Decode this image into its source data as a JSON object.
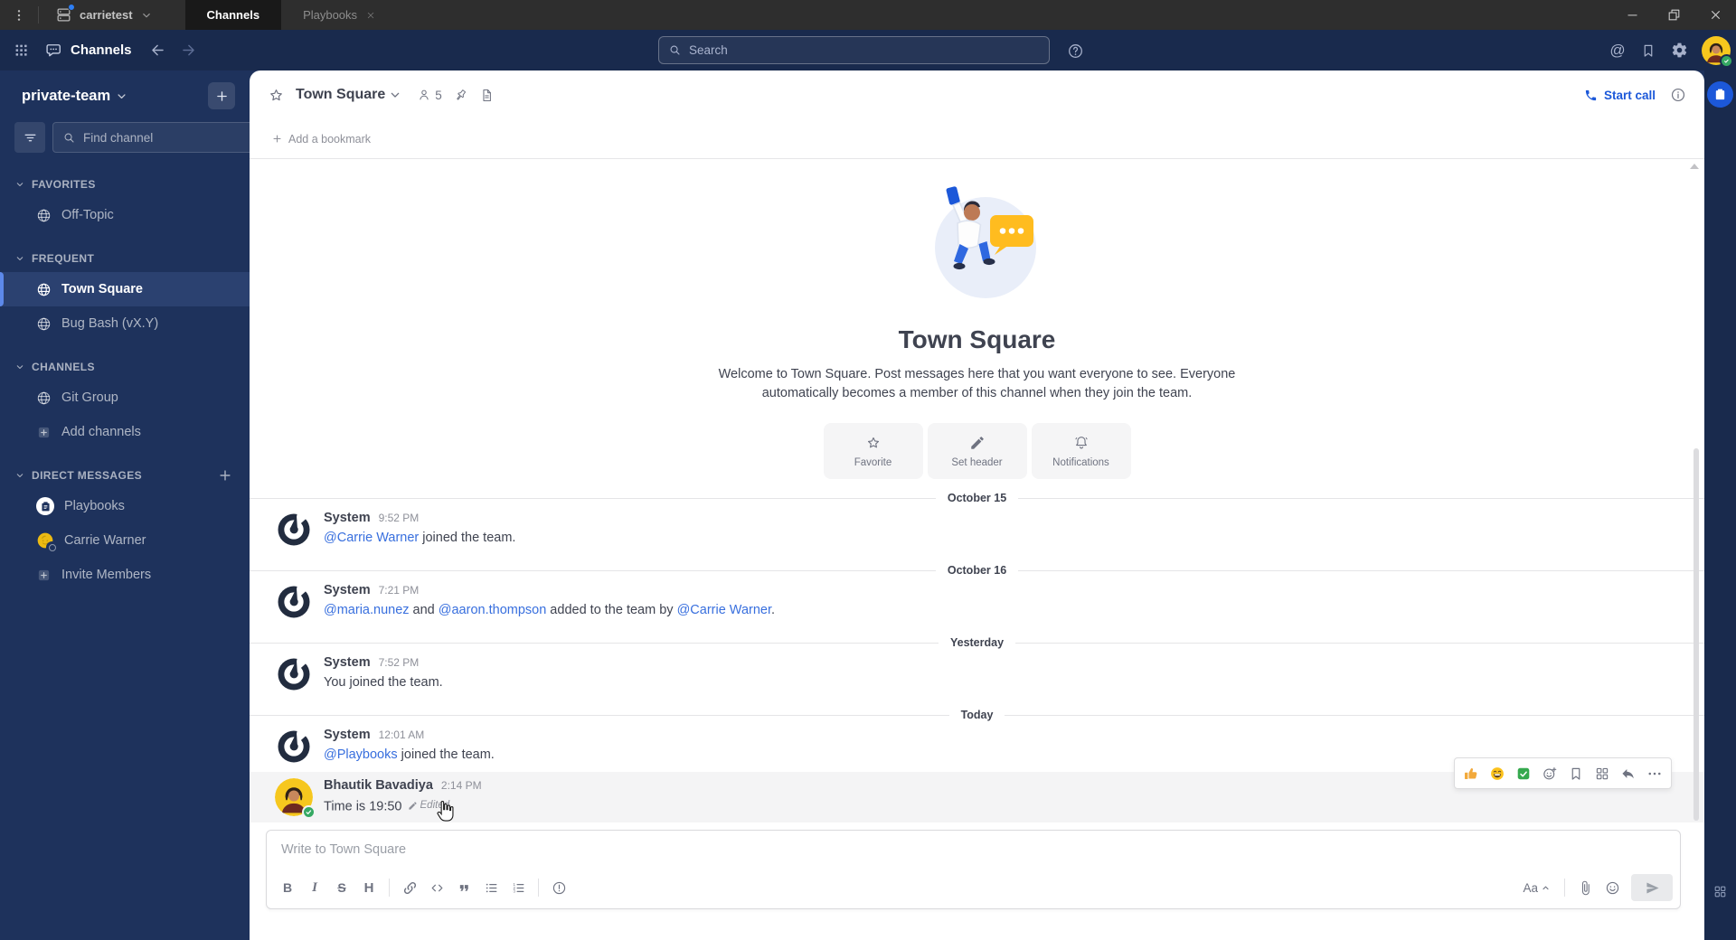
{
  "titlebar": {
    "server_name": "carrietest",
    "tabs": [
      {
        "label": "Channels",
        "active": true,
        "closable": false
      },
      {
        "label": "Playbooks",
        "active": false,
        "closable": true
      }
    ]
  },
  "header": {
    "product_name": "Channels",
    "search_placeholder": "Search"
  },
  "sidebar": {
    "team_name": "private-team",
    "find_channel_placeholder": "Find channel",
    "sections": [
      {
        "label": "FAVORITES",
        "add_button": false,
        "items": [
          {
            "label": "Off-Topic",
            "icon": "globe",
            "active": false
          }
        ]
      },
      {
        "label": "FREQUENT",
        "add_button": false,
        "items": [
          {
            "label": "Town Square",
            "icon": "globe",
            "active": true
          },
          {
            "label": "Bug Bash (vX.Y)",
            "icon": "globe",
            "active": false
          }
        ]
      },
      {
        "label": "CHANNELS",
        "add_button": false,
        "items": [
          {
            "label": "Git Group",
            "icon": "globe",
            "active": false
          },
          {
            "label": "Add channels",
            "icon": "plus-box",
            "active": false
          }
        ]
      },
      {
        "label": "DIRECT MESSAGES",
        "add_button": true,
        "items": [
          {
            "label": "Playbooks",
            "icon": "playbooks-avatar",
            "active": false
          },
          {
            "label": "Carrie Warner",
            "icon": "carrie-avatar",
            "active": false
          },
          {
            "label": "Invite Members",
            "icon": "plus-box",
            "active": false
          }
        ]
      }
    ]
  },
  "channel_header": {
    "name": "Town Square",
    "member_count": "5",
    "start_call_label": "Start call",
    "add_bookmark_label": "Add a bookmark"
  },
  "intro": {
    "title": "Town Square",
    "description": "Welcome to Town Square. Post messages here that you want everyone to see. Everyone automatically becomes a member of this channel when they join the team.",
    "actions": [
      {
        "label": "Favorite",
        "icon": "star"
      },
      {
        "label": "Set header",
        "icon": "pencil"
      },
      {
        "label": "Notifications",
        "icon": "bell"
      }
    ]
  },
  "timeline": [
    {
      "type": "divider",
      "label": "October 15"
    },
    {
      "type": "message",
      "author": "System",
      "avatar": "system-logo",
      "time": "9:52 PM",
      "segments": [
        {
          "text": "@Carrie Warner",
          "link": true
        },
        {
          "text": " joined the team.",
          "link": false
        }
      ]
    },
    {
      "type": "divider",
      "label": "October 16"
    },
    {
      "type": "message",
      "author": "System",
      "avatar": "system-logo",
      "time": "7:21 PM",
      "segments": [
        {
          "text": "@maria.nunez",
          "link": true
        },
        {
          "text": " and ",
          "link": false
        },
        {
          "text": "@aaron.thompson",
          "link": true
        },
        {
          "text": " added to the team by ",
          "link": false
        },
        {
          "text": "@Carrie Warner",
          "link": true
        },
        {
          "text": ".",
          "link": false
        }
      ]
    },
    {
      "type": "divider",
      "label": "Yesterday"
    },
    {
      "type": "message",
      "author": "System",
      "avatar": "system-logo",
      "time": "7:52 PM",
      "segments": [
        {
          "text": "You joined the team.",
          "link": false
        }
      ]
    },
    {
      "type": "divider",
      "label": "Today"
    },
    {
      "type": "message",
      "author": "System",
      "avatar": "system-logo",
      "time": "12:01 AM",
      "segments": [
        {
          "text": "@Playbooks",
          "link": true
        },
        {
          "text": " joined the team.",
          "link": false
        }
      ]
    },
    {
      "type": "message",
      "author": "Bhautik Bavadiya",
      "avatar": "bhautik-avatar",
      "time": "2:14 PM",
      "hovered": true,
      "segments": [
        {
          "text": "Time is 19:50",
          "link": false
        }
      ],
      "edited_label": "Edited"
    }
  ],
  "message_actions": [
    {
      "name": "thumbs-up-reaction",
      "icon": "emoji-thumb"
    },
    {
      "name": "grinning-reaction",
      "icon": "emoji-grin"
    },
    {
      "name": "check-mark-reaction",
      "icon": "emoji-check"
    },
    {
      "name": "add-reaction",
      "icon": "emoticon-plus"
    },
    {
      "name": "save-message",
      "icon": "bookmark"
    },
    {
      "name": "message-apps",
      "icon": "grid4"
    },
    {
      "name": "reply",
      "icon": "reply"
    },
    {
      "name": "more-actions",
      "icon": "dots-h"
    }
  ],
  "composer": {
    "placeholder": "Write to Town Square",
    "format_buttons": [
      {
        "name": "bold",
        "glyph": "B"
      },
      {
        "name": "italic",
        "glyph": "I"
      },
      {
        "name": "strikethrough",
        "glyph": "S"
      },
      {
        "name": "heading",
        "glyph": "H"
      },
      {
        "name": "separator"
      },
      {
        "name": "link",
        "icon": "link"
      },
      {
        "name": "code",
        "icon": "code"
      },
      {
        "name": "quote",
        "icon": "quote"
      },
      {
        "name": "bulleted-list",
        "icon": "ul"
      },
      {
        "name": "numbered-list",
        "icon": "ol"
      },
      {
        "name": "separator"
      },
      {
        "name": "message-priority",
        "icon": "priority"
      }
    ],
    "formatting_toggle_label": "Aa"
  },
  "colors": {
    "accent_blue": "#1c58d9",
    "link_blue": "#386fde",
    "sidebar_navy": "#1e325c",
    "header_navy": "#192a4d",
    "active_item_border": "#5d89ea",
    "online_green": "#35a963"
  }
}
